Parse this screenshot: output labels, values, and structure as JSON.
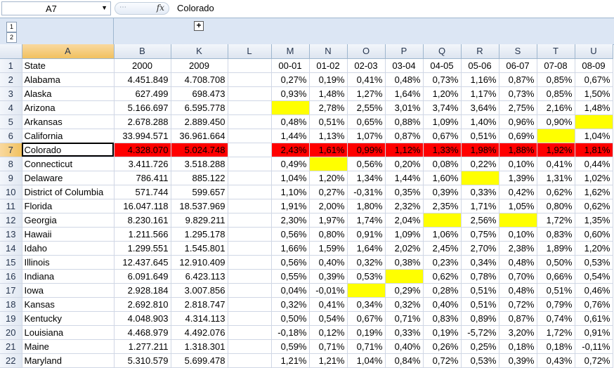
{
  "formula_bar": {
    "name_box": "A7",
    "fx_label": "fx",
    "value": "Colorado"
  },
  "outline": {
    "levels": [
      "1",
      "2"
    ],
    "expand_symbol": "+"
  },
  "columns": [
    "A",
    "B",
    "K",
    "L",
    "M",
    "N",
    "O",
    "P",
    "Q",
    "R",
    "S",
    "T",
    "U"
  ],
  "selected_cell": "A7",
  "colors": {
    "highlight_yellow": "#ffff00",
    "highlight_red": "#ff0000",
    "header_selected": "#f1c15f"
  },
  "rows": [
    {
      "n": "1",
      "cells": [
        "State",
        "2000",
        "2009",
        "",
        "00-01",
        "01-02",
        "02-03",
        "03-04",
        "04-05",
        "05-06",
        "06-07",
        "07-08",
        "08-09"
      ],
      "header": true
    },
    {
      "n": "2",
      "cells": [
        "Alabama",
        "4.451.849",
        "4.708.708",
        "",
        "0,27%",
        "0,19%",
        "0,41%",
        "0,48%",
        "0,73%",
        "1,16%",
        "0,87%",
        "0,85%",
        "0,67%"
      ]
    },
    {
      "n": "3",
      "cells": [
        "Alaska",
        "627.499",
        "698.473",
        "",
        "0,93%",
        "1,48%",
        "1,27%",
        "1,64%",
        "1,20%",
        "1,17%",
        "0,73%",
        "0,85%",
        "1,50%"
      ]
    },
    {
      "n": "4",
      "cells": [
        "Arizona",
        "5.166.697",
        "6.595.778",
        "",
        "",
        "2,78%",
        "2,55%",
        "3,01%",
        "3,74%",
        "3,64%",
        "2,75%",
        "2,16%",
        "1,48%"
      ],
      "yellow": [
        4
      ]
    },
    {
      "n": "5",
      "cells": [
        "Arkansas",
        "2.678.288",
        "2.889.450",
        "",
        "0,48%",
        "0,51%",
        "0,65%",
        "0,88%",
        "1,09%",
        "1,40%",
        "0,96%",
        "0,90%",
        ""
      ],
      "yellow": [
        12
      ]
    },
    {
      "n": "6",
      "cells": [
        "California",
        "33.994.571",
        "36.961.664",
        "",
        "1,44%",
        "1,13%",
        "1,07%",
        "0,87%",
        "0,67%",
        "0,51%",
        "0,69%",
        "",
        "1,04%"
      ],
      "yellow": [
        11
      ]
    },
    {
      "n": "7",
      "cells": [
        "Colorado",
        "4.328.070",
        "5.024.748",
        "",
        "2,43%",
        "1,61%",
        "0,99%",
        "1,12%",
        "1,33%",
        "1,98%",
        "1,88%",
        "1,92%",
        "1,81%"
      ],
      "red": [
        1,
        2,
        4,
        5,
        6,
        7,
        8,
        9,
        10,
        11,
        12
      ],
      "selected": true
    },
    {
      "n": "8",
      "cells": [
        "Connecticut",
        "3.411.726",
        "3.518.288",
        "",
        "0,49%",
        "",
        "0,56%",
        "0,20%",
        "0,08%",
        "0,22%",
        "0,10%",
        "0,41%",
        "0,44%"
      ],
      "yellow": [
        5
      ]
    },
    {
      "n": "9",
      "cells": [
        "Delaware",
        "786.411",
        "885.122",
        "",
        "1,04%",
        "1,20%",
        "1,34%",
        "1,44%",
        "1,60%",
        "",
        "1,39%",
        "1,31%",
        "1,02%"
      ],
      "yellow": [
        9
      ]
    },
    {
      "n": "10",
      "cells": [
        "District of Columbia",
        "571.744",
        "599.657",
        "",
        "1,10%",
        "0,27%",
        "-0,31%",
        "0,35%",
        "0,39%",
        "0,33%",
        "0,42%",
        "0,62%",
        "1,62%"
      ]
    },
    {
      "n": "11",
      "cells": [
        "Florida",
        "16.047.118",
        "18.537.969",
        "",
        "1,91%",
        "2,00%",
        "1,80%",
        "2,32%",
        "2,35%",
        "1,71%",
        "1,05%",
        "0,80%",
        "0,62%"
      ]
    },
    {
      "n": "12",
      "cells": [
        "Georgia",
        "8.230.161",
        "9.829.211",
        "",
        "2,30%",
        "1,97%",
        "1,74%",
        "2,04%",
        "",
        "2,56%",
        "",
        "1,72%",
        "1,35%"
      ],
      "yellow": [
        8,
        10
      ]
    },
    {
      "n": "13",
      "cells": [
        "Hawaii",
        "1.211.566",
        "1.295.178",
        "",
        "0,56%",
        "0,80%",
        "0,91%",
        "1,09%",
        "1,06%",
        "0,75%",
        "0,10%",
        "0,83%",
        "0,60%"
      ]
    },
    {
      "n": "14",
      "cells": [
        "Idaho",
        "1.299.551",
        "1.545.801",
        "",
        "1,66%",
        "1,59%",
        "1,64%",
        "2,02%",
        "2,45%",
        "2,70%",
        "2,38%",
        "1,89%",
        "1,20%"
      ]
    },
    {
      "n": "15",
      "cells": [
        "Illinois",
        "12.437.645",
        "12.910.409",
        "",
        "0,56%",
        "0,40%",
        "0,32%",
        "0,38%",
        "0,23%",
        "0,34%",
        "0,48%",
        "0,50%",
        "0,53%"
      ]
    },
    {
      "n": "16",
      "cells": [
        "Indiana",
        "6.091.649",
        "6.423.113",
        "",
        "0,55%",
        "0,39%",
        "0,53%",
        "",
        "0,62%",
        "0,78%",
        "0,70%",
        "0,66%",
        "0,54%"
      ],
      "yellow": [
        7
      ]
    },
    {
      "n": "17",
      "cells": [
        "Iowa",
        "2.928.184",
        "3.007.856",
        "",
        "0,04%",
        "-0,01%",
        "",
        "0,29%",
        "0,28%",
        "0,51%",
        "0,48%",
        "0,51%",
        "0,46%"
      ],
      "yellow": [
        6
      ]
    },
    {
      "n": "18",
      "cells": [
        "Kansas",
        "2.692.810",
        "2.818.747",
        "",
        "0,32%",
        "0,41%",
        "0,34%",
        "0,32%",
        "0,40%",
        "0,51%",
        "0,72%",
        "0,79%",
        "0,76%"
      ]
    },
    {
      "n": "19",
      "cells": [
        "Kentucky",
        "4.048.903",
        "4.314.113",
        "",
        "0,50%",
        "0,54%",
        "0,67%",
        "0,71%",
        "0,83%",
        "0,89%",
        "0,87%",
        "0,74%",
        "0,61%"
      ]
    },
    {
      "n": "20",
      "cells": [
        "Louisiana",
        "4.468.979",
        "4.492.076",
        "",
        "-0,18%",
        "0,12%",
        "0,19%",
        "0,33%",
        "0,19%",
        "-5,72%",
        "3,20%",
        "1,72%",
        "0,91%"
      ]
    },
    {
      "n": "21",
      "cells": [
        "Maine",
        "1.277.211",
        "1.318.301",
        "",
        "0,59%",
        "0,71%",
        "0,71%",
        "0,40%",
        "0,26%",
        "0,25%",
        "0,18%",
        "0,18%",
        "-0,11%"
      ]
    },
    {
      "n": "22",
      "cells": [
        "Maryland",
        "5.310.579",
        "5.699.478",
        "",
        "1,21%",
        "1,21%",
        "1,04%",
        "0,84%",
        "0,72%",
        "0,53%",
        "0,39%",
        "0,43%",
        "0,72%"
      ]
    }
  ]
}
